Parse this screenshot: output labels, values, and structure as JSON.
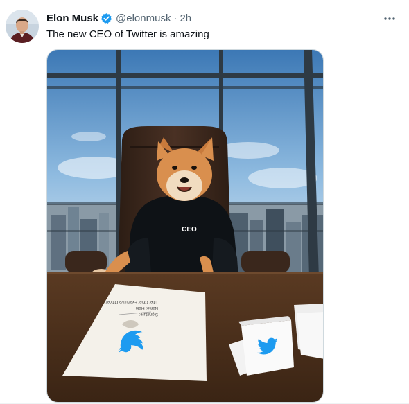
{
  "author": {
    "name": "Elon Musk",
    "handle": "@elonmusk",
    "time": "2h",
    "verified_color": "#1d9bf0"
  },
  "tweet": {
    "text": "The new CEO of Twitter is amazing"
  },
  "photo": {
    "sweater_text": "CEO",
    "document_lines": [
      "Signature:",
      "Name:  Floki",
      "Title:  Chief Executive Officer"
    ],
    "brand_color": "#1d9bf0"
  },
  "icons": {
    "more": "more-dots-icon",
    "verified": "verified-badge-icon",
    "logo": "twitter-bird-icon"
  }
}
